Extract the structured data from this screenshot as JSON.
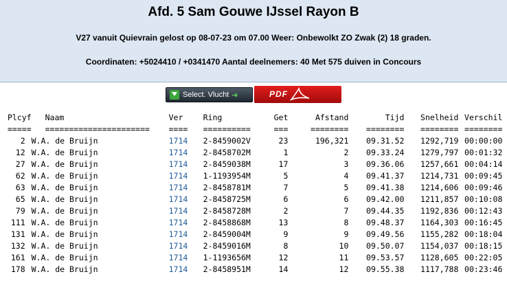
{
  "header": {
    "title": "Afd. 5 Sam Gouwe IJssel Rayon B",
    "flight_info": "V27 vanuit Quievrain gelost op 08-07-23 om 07.00 Weer: Onbewolkt ZO Zwak (2) 18 graden.",
    "coords_info": "Coordinaten: +5024410 / +0341470 Aantal deelnemers: 40 Met 575 duiven in Concours"
  },
  "toolbar": {
    "select_label": "Select. Vlucht",
    "pdf_label": "PDF"
  },
  "table": {
    "headers": [
      "Plcyf",
      "Naam",
      "Ver",
      "Ring",
      "Get",
      "Afstand",
      "Tijd",
      "Snelheid",
      "Verschil"
    ],
    "underlines": [
      "=====",
      "======================",
      "====",
      "==========",
      "===",
      "========",
      "========",
      "========",
      "========"
    ],
    "rows": [
      [
        "2",
        "W.A. de Bruijn",
        "1714",
        "2-8459002V",
        "23",
        "196,321",
        "09.31.52",
        "1292,719",
        "00:00:00"
      ],
      [
        "12",
        "W.A. de Bruijn",
        "1714",
        "2-8458702M",
        "1",
        "2",
        "09.33.24",
        "1279,797",
        "00:01:32"
      ],
      [
        "27",
        "W.A. de Bruijn",
        "1714",
        "2-8459038M",
        "17",
        "3",
        "09.36.06",
        "1257,661",
        "00:04:14"
      ],
      [
        "62",
        "W.A. de Bruijn",
        "1714",
        "1-1193954M",
        "5",
        "4",
        "09.41.37",
        "1214,731",
        "00:09:45"
      ],
      [
        "63",
        "W.A. de Bruijn",
        "1714",
        "2-8458781M",
        "7",
        "5",
        "09.41.38",
        "1214,606",
        "00:09:46"
      ],
      [
        "65",
        "W.A. de Bruijn",
        "1714",
        "2-8458725M",
        "6",
        "6",
        "09.42.00",
        "1211,857",
        "00:10:08"
      ],
      [
        "79",
        "W.A. de Bruijn",
        "1714",
        "2-8458728M",
        "2",
        "7",
        "09.44.35",
        "1192,836",
        "00:12:43"
      ],
      [
        "111",
        "W.A. de Bruijn",
        "1714",
        "2-8458868M",
        "13",
        "8",
        "09.48.37",
        "1164,303",
        "00:16:45"
      ],
      [
        "131",
        "W.A. de Bruijn",
        "1714",
        "2-8459004M",
        "9",
        "9",
        "09.49.56",
        "1155,282",
        "00:18:04"
      ],
      [
        "132",
        "W.A. de Bruijn",
        "1714",
        "2-8459016M",
        "8",
        "10",
        "09.50.07",
        "1154,037",
        "00:18:15"
      ],
      [
        "161",
        "W.A. de Bruijn",
        "1714",
        "1-1193656M",
        "12",
        "11",
        "09.53.57",
        "1128,605",
        "00:22:05"
      ],
      [
        "178",
        "W.A. de Bruijn",
        "1714",
        "2-8458951M",
        "14",
        "12",
        "09.55.38",
        "1117,788",
        "00:23:46"
      ]
    ]
  },
  "colors": {
    "header_bg": "#dde7f3",
    "link": "#1e5a9a",
    "pdf_red": "#d01010"
  },
  "icons": [
    "download-icon",
    "arrow-right-icon",
    "acrobat-icon"
  ]
}
